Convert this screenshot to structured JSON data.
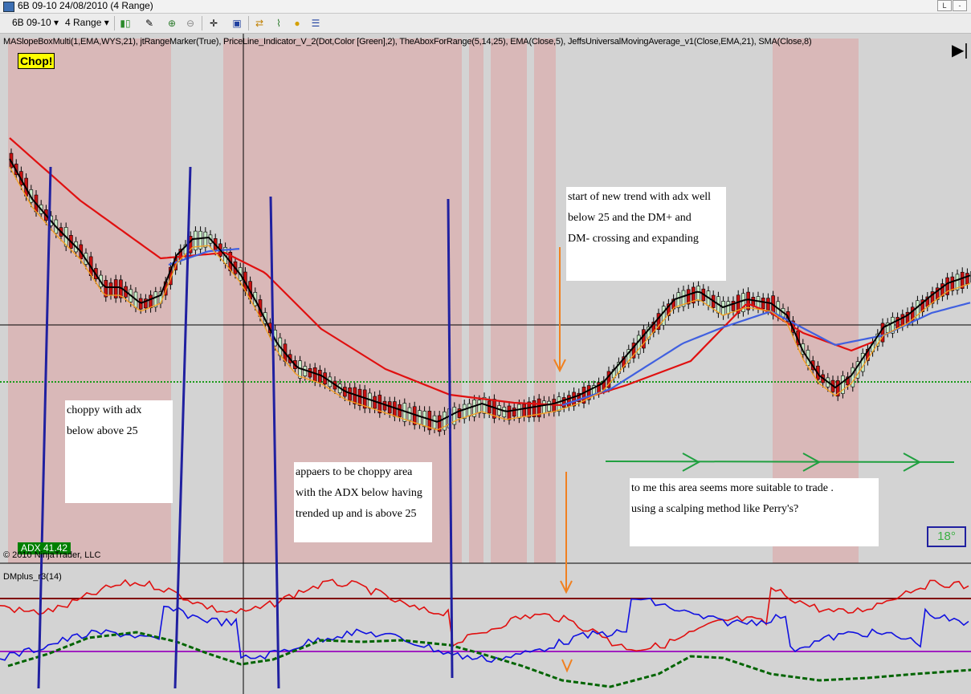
{
  "window": {
    "title": "6B 09-10  24/08/2010 (4 Range)",
    "buttons": [
      "L",
      "-",
      "×"
    ]
  },
  "toolbar": {
    "instrument": "6B 09-10",
    "period": "4 Range",
    "icons": [
      "candlestick-icon",
      "pencil-icon",
      "zoom-in-icon",
      "zoom-out-icon",
      "crosshair-icon",
      "properties-icon",
      "strategy-icon",
      "indicator-icon",
      "money-icon",
      "data-box-icon"
    ]
  },
  "chart": {
    "indicators_label": "MASlopeBoxMulti(1,EMA,WYS,21), jtRangeMarker(True), PriceLine_Indicator_V_2(Dot,Color [Green],2), TheAboxForRange(5,14,25), EMA(Close,5), JeffsUniversalMovingAverage_v1(Close,EMA,21), SMA(Close,8)",
    "chop_label": "Chop!",
    "adx_label": "ADX 41.42",
    "copyright": "© 2010 NinjaTrader, LLC",
    "dm_label": "DMplus_r3(14)",
    "temp_label": "18°",
    "colors": {
      "chop_zone": "#d9b3b3",
      "ema21": "#e01010",
      "sma": "#000000",
      "ema5": "#f5a020",
      "slow_ma": "#4060e0",
      "dm_plus": "#e01010",
      "dm_minus": "#1010e0",
      "adx": "#006400"
    }
  },
  "notes": {
    "choppy": [
      "choppy with adx",
      "below above 25"
    ],
    "appears": [
      "appaers to be choppy area",
      "with the ADX below having",
      "trended up and is above 25"
    ],
    "trend": [
      "start of new trend with adx well",
      "below 25 and the DM+ and",
      "DM- crossing and expanding"
    ],
    "scalp": [
      "to me this area seems more suitable to trade .",
      "using a scalping method like Perry's?"
    ]
  }
}
